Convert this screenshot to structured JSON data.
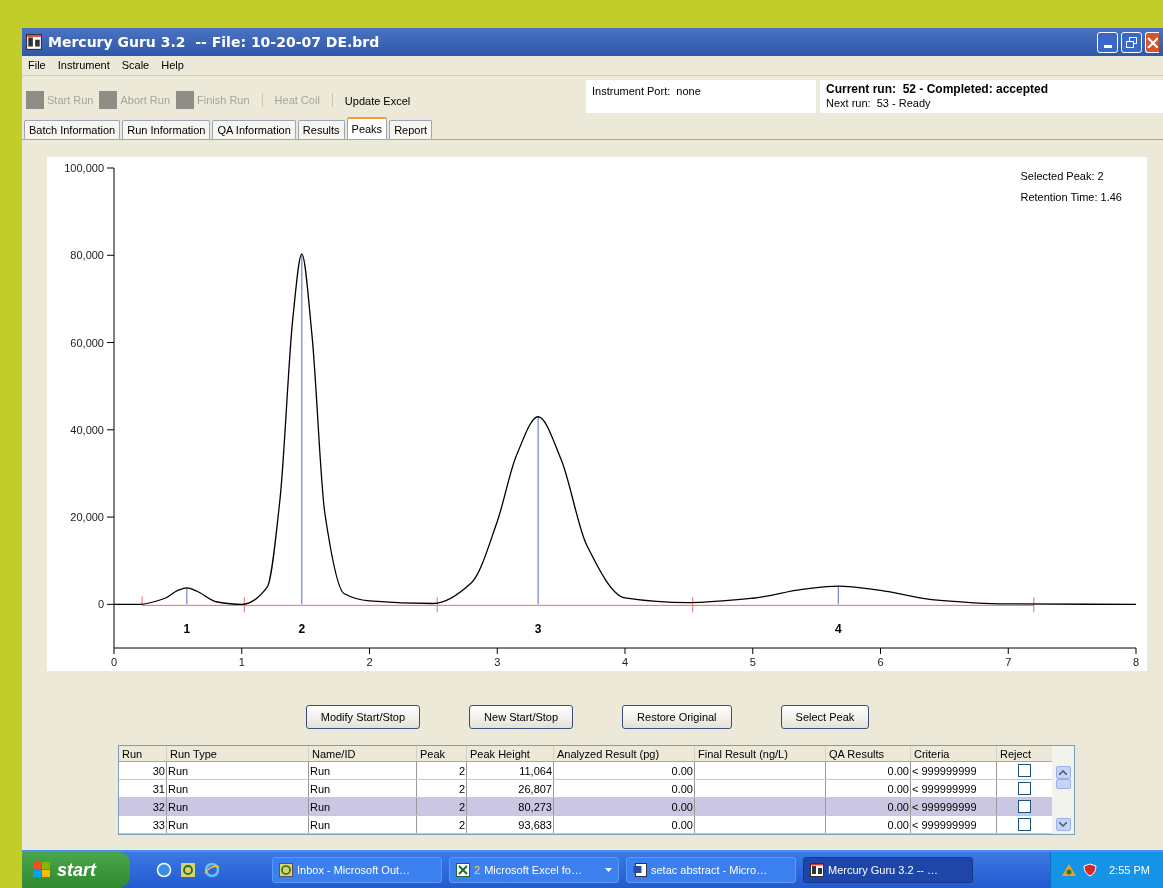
{
  "window": {
    "title": "Mercury Guru 3.2  -- File: 10-20-07 DE.brd"
  },
  "menu": [
    "File",
    "Instrument",
    "Scale",
    "Help"
  ],
  "toolbar": [
    {
      "label": "Start Run",
      "kind": "icon-button",
      "disabled": true
    },
    {
      "label": "Abort Run",
      "kind": "icon-button",
      "disabled": true
    },
    {
      "label": "Finish Run",
      "kind": "icon-button",
      "disabled": true
    },
    {
      "label": "Heat Coil",
      "kind": "text-button",
      "disabled": true
    },
    {
      "label": "Update Excel",
      "kind": "text-button",
      "disabled": false
    }
  ],
  "status": {
    "instrument_port": "Instrument Port:  none",
    "current_run": "Current run:  52 - Completed: accepted",
    "next_run": "Next run:  53 - Ready"
  },
  "tabs": [
    {
      "label": "Batch Information",
      "selected": false
    },
    {
      "label": "Run Information",
      "selected": false
    },
    {
      "label": "QA Information",
      "selected": false
    },
    {
      "label": "Results",
      "selected": false
    },
    {
      "label": "Peaks",
      "selected": true
    },
    {
      "label": "Report",
      "selected": false
    }
  ],
  "chart": {
    "info": [
      "Selected Peak: 2",
      "Retention Time: 1.46"
    ],
    "chart_data": {
      "type": "line",
      "x": [
        0,
        0.2,
        0.4,
        0.5,
        0.57,
        0.65,
        0.8,
        1.0,
        1.2,
        1.3,
        1.4,
        1.47,
        1.55,
        1.65,
        1.8,
        2.0,
        2.5,
        2.8,
        3.0,
        3.15,
        3.32,
        3.5,
        3.7,
        4.0,
        4.5,
        5.0,
        5.4,
        5.67,
        6.0,
        6.4,
        7.0,
        8.0
      ],
      "series": [
        {
          "color": "#000000",
          "values": [
            0,
            0,
            1400,
            3200,
            3800,
            3000,
            600,
            0,
            4000,
            24300,
            65600,
            80300,
            61600,
            21000,
            2500,
            800,
            200,
            5000,
            19000,
            34100,
            43000,
            33200,
            13600,
            1500,
            400,
            1400,
            3500,
            4200,
            3200,
            1100,
            100,
            0
          ]
        }
      ],
      "xlim": [
        0,
        8
      ],
      "ylim": [
        -10000,
        100000
      ],
      "xticks": [
        0,
        1,
        2,
        3,
        4,
        5,
        6,
        7,
        8
      ],
      "yticks": [
        {
          "value": 0,
          "label": "0"
        },
        {
          "value": 20000,
          "label": "20,000"
        },
        {
          "value": 40000,
          "label": "40,000"
        },
        {
          "value": 60000,
          "label": "60,000"
        },
        {
          "value": 80000,
          "label": "80,000"
        },
        {
          "value": 100000,
          "label": "100,000"
        }
      ],
      "annotations": [
        "1",
        "2",
        "3",
        "4"
      ]
    }
  },
  "buttons": [
    "Modify Start/Stop",
    "New Start/Stop",
    "Restore Original",
    "Select Peak"
  ],
  "table": {
    "columns": [
      "Run",
      "Run Type",
      "Name/ID",
      "Peak",
      "Peak Height",
      "Analyzed Result (pg)",
      "Final Result (ng/L)",
      "QA Results",
      "Criteria",
      "Reject"
    ],
    "rows": [
      {
        "cells": [
          "30",
          "Run",
          "Run",
          "2",
          "11,064",
          "0.00",
          null,
          "0.00",
          "< 999999999"
        ],
        "reject": false,
        "selected": false
      },
      {
        "cells": [
          "31",
          "Run",
          "Run",
          "2",
          "26,807",
          "0.00",
          null,
          "0.00",
          "< 999999999"
        ],
        "reject": false,
        "selected": false
      },
      {
        "cells": [
          "32",
          "Run",
          "Run",
          "2",
          "80,273",
          "0.00",
          null,
          "0.00",
          "< 999999999"
        ],
        "reject": false,
        "selected": true
      },
      {
        "cells": [
          "33",
          "Run",
          "Run",
          "2",
          "93,683",
          "0.00",
          null,
          "0.00",
          "< 999999999"
        ],
        "reject": false,
        "selected": false
      }
    ]
  },
  "taskbar": {
    "start": "start",
    "tasks": [
      {
        "kind": "mail",
        "label": "Inbox - Microsoft Out…",
        "selected": false
      },
      {
        "kind": "sheet",
        "count": "2",
        "label": "Microsoft Excel fo…",
        "selected": false
      },
      {
        "kind": "doc",
        "label": "setac abstract - Micro…",
        "selected": false
      },
      {
        "kind": "app",
        "label": "Mercury Guru 3.2  -- …",
        "selected": true
      }
    ],
    "clock": "2:55 PM"
  }
}
